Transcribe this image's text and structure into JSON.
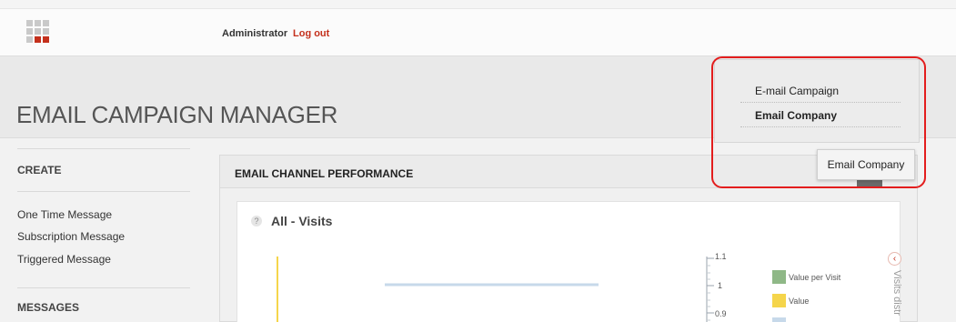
{
  "header": {
    "user": "Administrator",
    "logout_label": "Log out",
    "logo_accent": "#c4301c"
  },
  "page": {
    "title": "EMAIL CAMPAIGN MANAGER"
  },
  "sidebar": {
    "create_heading": "CREATE",
    "create_items": [
      "One Time Message",
      "Subscription Message",
      "Triggered Message"
    ],
    "messages_heading": "MESSAGES"
  },
  "content": {
    "title": "EMAIL CHANNEL PERFORMANCE",
    "card_title": "All - Visits",
    "help_icon": "?",
    "legend": [
      {
        "label": "Value per Visit",
        "color": "#8fb887"
      },
      {
        "label": "Value",
        "color": "#f5d54b"
      },
      {
        "label": "",
        "color": "#c7d9ea"
      }
    ],
    "axis_ticks": [
      "1.1",
      "1",
      "0.9"
    ],
    "side_label": "Visits distr",
    "side_arrow_icon": "‹"
  },
  "dropdown": {
    "items": [
      "E-mail Campaign",
      "Email Company"
    ],
    "current": "Email Company"
  }
}
